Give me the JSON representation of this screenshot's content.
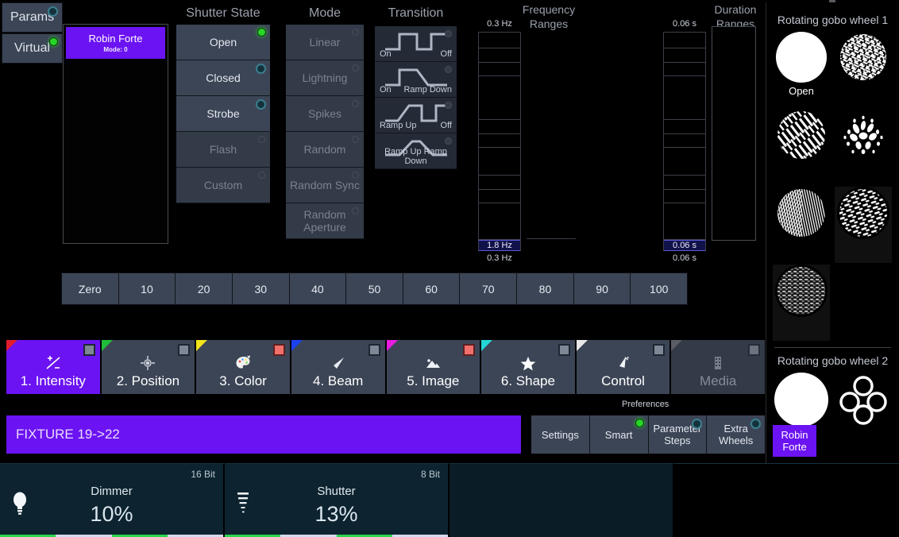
{
  "toggles": [
    {
      "label": "Params",
      "led": "teal"
    },
    {
      "label": "Virtual",
      "led": "green"
    }
  ],
  "fixture_panel": {
    "chip_name": "Robin Forte",
    "chip_mode": "Mode: 0"
  },
  "columns": {
    "shutter_state": {
      "title": "Shutter State",
      "items": [
        {
          "label": "Open",
          "led": "green",
          "disabled": false
        },
        {
          "label": "Closed",
          "led": "teal",
          "disabled": false
        },
        {
          "label": "Strobe",
          "led": "teal",
          "disabled": false
        },
        {
          "label": "Flash",
          "led": "dim",
          "disabled": true
        },
        {
          "label": "Custom",
          "led": "dim",
          "disabled": true
        }
      ]
    },
    "mode": {
      "title": "Mode",
      "items": [
        {
          "label": "Linear",
          "led": "dim",
          "disabled": true
        },
        {
          "label": "Lightning",
          "led": "dim",
          "disabled": true
        },
        {
          "label": "Spikes",
          "led": "dim",
          "disabled": true
        },
        {
          "label": "Random",
          "led": "dim",
          "disabled": true
        },
        {
          "label": "Random Sync",
          "led": "dim",
          "disabled": true
        },
        {
          "label": "Random Aperture",
          "led": "dim",
          "disabled": true
        }
      ]
    },
    "transition": {
      "title": "Transition",
      "items": [
        {
          "left": "On",
          "right": "Off",
          "wide": null,
          "shape": "on-off"
        },
        {
          "left": "On",
          "right": "Ramp Down",
          "wide": null,
          "shape": "on-rampdown"
        },
        {
          "left": "Ramp Up",
          "right": "Off",
          "wide": null,
          "shape": "rampup-off"
        },
        {
          "left": null,
          "right": null,
          "wide": "Ramp Up Ramp Down",
          "shape": "rampup-rampdown"
        }
      ]
    }
  },
  "frequency_ranges": {
    "title_line1": "Frequency",
    "title_line2": "Ranges",
    "top_label": "0.3 Hz",
    "selected_label": "1.8 Hz",
    "bottom_label": "0.3 Hz"
  },
  "duration_ranges": {
    "title_line1": "Duration",
    "title_line2": "Ranges",
    "top_label": "0.06 s",
    "selected_label": "0.06 s",
    "bottom_label": "0.06 s"
  },
  "percent_row": [
    "Zero",
    "10",
    "20",
    "30",
    "40",
    "50",
    "60",
    "70",
    "80",
    "90",
    "100"
  ],
  "tabs": [
    {
      "label": "1. Intensity",
      "icon": "plus-minus-icon",
      "corner": "#e01d2b",
      "square": "#7e8796",
      "state": "active"
    },
    {
      "label": "2. Position",
      "icon": "crosshair-icon",
      "corner": "#1fbf3a",
      "square": "#7e8796",
      "state": "normal"
    },
    {
      "label": "3. Color",
      "icon": "palette-icon",
      "corner": "#f2e31c",
      "square": "#f2706b",
      "state": "normal"
    },
    {
      "label": "4. Beam",
      "icon": "beam-cone-icon",
      "corner": "#1b42f0",
      "square": "#7e8796",
      "state": "normal"
    },
    {
      "label": "5. Image",
      "icon": "landscape-icon",
      "corner": "#e81ce0",
      "square": "#f2706b",
      "state": "normal"
    },
    {
      "label": "6. Shape",
      "icon": "star-icon",
      "corner": "#24d6d6",
      "square": "#7e8796",
      "state": "normal"
    },
    {
      "label": "Control",
      "icon": "satellite-icon",
      "corner": "#e8e8e8",
      "square": "#7e8796",
      "state": "normal"
    },
    {
      "label": "Media",
      "icon": "film-icon",
      "corner": "#5c5c66",
      "square": "#7e8796",
      "state": "dim"
    }
  ],
  "fixture_bar": {
    "text": "FIXTURE 19->22"
  },
  "preferences": {
    "title": "Preferences",
    "buttons": [
      {
        "label": "Settings",
        "led": "none"
      },
      {
        "label": "Smart",
        "led": "green"
      },
      {
        "label": "Parameter Steps",
        "led": "teal"
      },
      {
        "label": "Extra Wheels",
        "led": "teal"
      }
    ]
  },
  "encoders": [
    {
      "name": "Dimmer",
      "value": "10%",
      "bit": "16 Bit",
      "icon": "bulb-icon"
    },
    {
      "name": "Shutter",
      "value": "13%",
      "bit": "8 Bit",
      "icon": "shutter-icon"
    }
  ],
  "gobo_wheel_1": {
    "title": "Rotating gobo wheel 1",
    "items": [
      {
        "caption": "Open",
        "pattern": "open",
        "selected": false
      },
      {
        "caption": "",
        "pattern": "squiggle-dense",
        "selected": false
      },
      {
        "caption": "",
        "pattern": "diagonal-strokes",
        "selected": false
      },
      {
        "caption": "",
        "pattern": "petal-burst",
        "selected": false
      },
      {
        "caption": "",
        "pattern": "fine-lines",
        "selected": false
      },
      {
        "caption": "",
        "pattern": "dash-texture",
        "selected": true
      },
      {
        "caption": "",
        "pattern": "ripple-water",
        "selected": true
      }
    ]
  },
  "gobo_wheel_2": {
    "title": "Rotating gobo wheel 2",
    "items": [
      {
        "caption": "",
        "pattern": "open",
        "selected": false
      },
      {
        "caption": "",
        "pattern": "rings-cluster",
        "selected": false
      }
    ]
  },
  "robin_button": {
    "line1": "Robin",
    "line2": "Forte"
  }
}
